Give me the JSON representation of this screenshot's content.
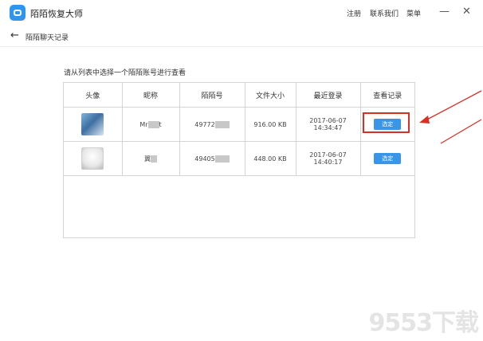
{
  "app": {
    "title": "陌陌恢复大师"
  },
  "topbar": {
    "register": "注册",
    "contact": "联系我们",
    "menu": "菜单",
    "minimize": "—",
    "close": "✕"
  },
  "subbar": {
    "back_icon": "←",
    "title": "陌陌聊天记录"
  },
  "instruction": "请从列表中选择一个陌陌账号进行查看",
  "table": {
    "headers": [
      "头像",
      "昵称",
      "陌陌号",
      "文件大小",
      "最近登录",
      "查看记录"
    ],
    "rows": [
      {
        "nickname": "Mr",
        "nickname_suffix": "t",
        "momo_id": "49772",
        "size": "916.00 KB",
        "last_login": "2017-06-07 14:34:47",
        "action": "选定"
      },
      {
        "nickname": "翼",
        "nickname_suffix": "",
        "momo_id": "49405",
        "size": "448.00 KB",
        "last_login": "2017-06-07 14:40:17",
        "action": "选定"
      }
    ]
  },
  "watermark": "9553下载",
  "colors": {
    "accent": "#3a95e8",
    "highlight": "#d93025"
  }
}
